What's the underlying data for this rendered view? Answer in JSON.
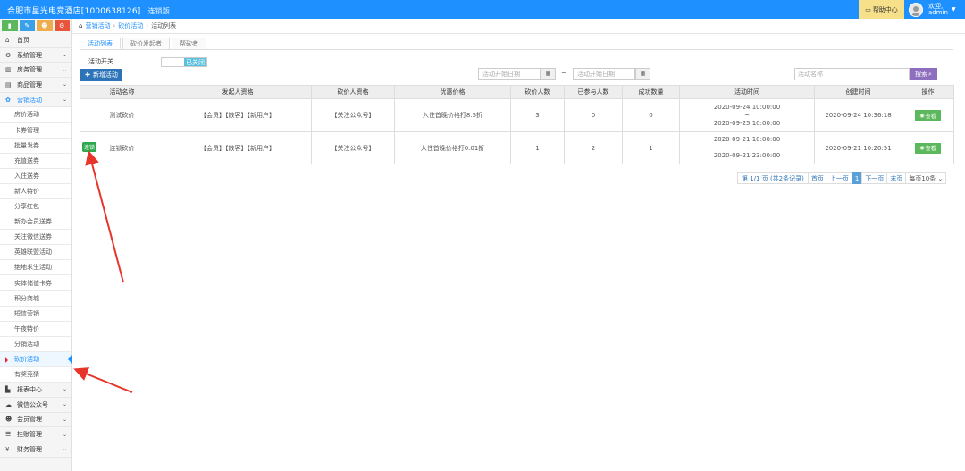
{
  "header": {
    "hotel_name": "合肥市星光电竞酒店[1000638126]",
    "edition": "连锁版",
    "help": "帮助中心",
    "greeting": "欢迎,",
    "username": "admin"
  },
  "sidebar": {
    "items": [
      {
        "label": "首页",
        "icon": "home-icon"
      },
      {
        "label": "系统管理",
        "icon": "gear-icon"
      },
      {
        "label": "房务管理",
        "icon": "bank-icon"
      },
      {
        "label": "商品管理",
        "icon": "grid-icon"
      },
      {
        "label": "营销活动",
        "icon": "gift-icon"
      }
    ],
    "sub_items": [
      "房价活动",
      "卡券管理",
      "批量发券",
      "充值送券",
      "入住送券",
      "新人特价",
      "分享红包",
      "新办会员送券",
      "关注微信送券",
      "英雄联盟活动",
      "绝地求生活动",
      "实体储值卡券",
      "积分商城",
      "短信营销",
      "午夜特价",
      "分销活动",
      "砍价活动",
      "有奖竞猜"
    ],
    "bottom_items": [
      {
        "label": "报表中心",
        "icon": "chart-icon"
      },
      {
        "label": "微信公众号",
        "icon": "cloud-icon"
      },
      {
        "label": "会员管理",
        "icon": "users-icon"
      },
      {
        "label": "挂账管理",
        "icon": "list-icon"
      },
      {
        "label": "财务管理",
        "icon": "finance-icon"
      }
    ],
    "current_sub": "砍价活动"
  },
  "breadcrumb": [
    "营销活动",
    "砍价活动",
    "活动列表"
  ],
  "tabs": [
    "活动列表",
    "砍价发起者",
    "帮砍者"
  ],
  "filters": {
    "switch_label": "活动开关",
    "switch_state": "已关闭",
    "new_button": "新增活动",
    "date_start_placeholder": "活动开始日期",
    "date_end_placeholder": "活动开始日期",
    "tilde": "~",
    "search_placeholder": "活动名称",
    "search_button": "搜索"
  },
  "table": {
    "columns": [
      "活动名称",
      "发起人资格",
      "砍价人资格",
      "优惠价格",
      "砍价人数",
      "已参与人数",
      "成功数量",
      "活动时间",
      "创建时间",
      "操作"
    ],
    "rows": [
      {
        "name": "测试砍价",
        "initiator": "【会员】【散客】【新用户】",
        "bargainer": "【关注公众号】",
        "price": "入住首晚价格打8.5折",
        "cut_count": "3",
        "joined": "0",
        "success": "0",
        "start": "2020-09-24 10:00:00",
        "sep": "~",
        "end": "2020-09-25 10:00:00",
        "created": "2020-09-24 10:36:18",
        "action": "查看",
        "badge": ""
      },
      {
        "name": "连锁砍价",
        "initiator": "【会员】【散客】【新用户】",
        "bargainer": "【关注公众号】",
        "price": "入住首晚价格打0.01折",
        "cut_count": "1",
        "joined": "2",
        "success": "1",
        "start": "2020-09-21 10:00:00",
        "sep": "~",
        "end": "2020-09-21 23:00:00",
        "created": "2020-09-21 10:20:51",
        "action": "查看",
        "badge": "连锁"
      }
    ]
  },
  "pager": {
    "info": "第 1/1 页 (共2条记录)",
    "first": "首页",
    "prev": "上一页",
    "current": "1",
    "next": "下一页",
    "last": "末页",
    "page_size": "每页10条 ⌄"
  },
  "colors": {
    "topbar": "#1e90ff",
    "primary_button": "#2c73b8",
    "search_button": "#8e6fbf",
    "view_button": "#5cb85c",
    "annotation_arrow": "#e8352b"
  }
}
